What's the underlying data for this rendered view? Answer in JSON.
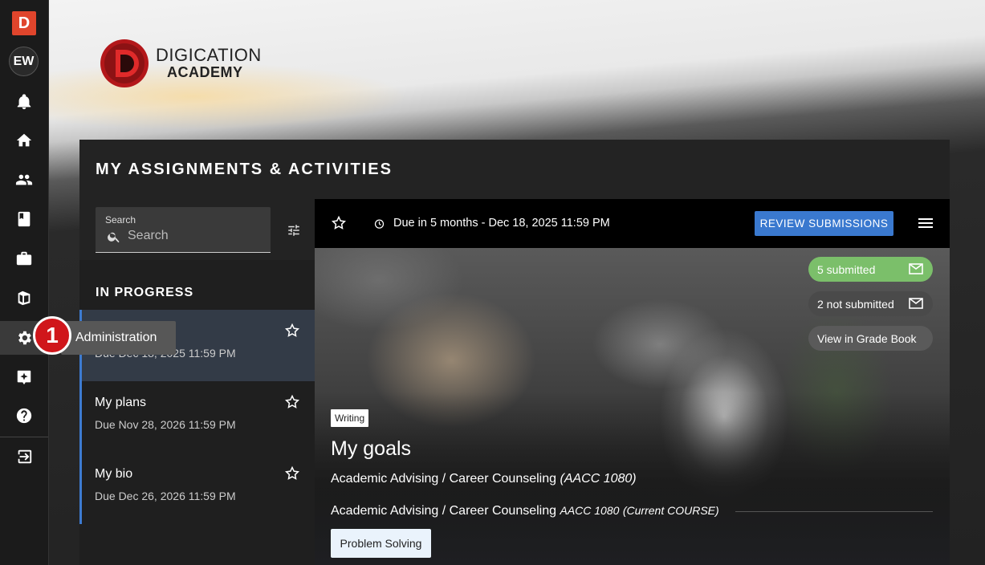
{
  "rail": {
    "logo_letter": "D",
    "avatar_initials": "EW"
  },
  "tooltip": {
    "label": "Administration"
  },
  "step_badge": {
    "number": "1"
  },
  "brand": {
    "line1": "DIGICATION",
    "line2": "ACADEMY"
  },
  "panel": {
    "title": "MY ASSIGNMENTS & ACTIVITIES"
  },
  "search": {
    "label": "Search",
    "placeholder": "Search"
  },
  "list": {
    "heading": "IN PROGRESS",
    "items": [
      {
        "title": "",
        "due": "Due Dec 18, 2025 11:59 PM"
      },
      {
        "title": "My plans",
        "due": "Due Nov 28, 2026 11:59 PM"
      },
      {
        "title": "My bio",
        "due": "Due Dec 26, 2026 11:59 PM"
      }
    ]
  },
  "detail": {
    "due_text": "Due in 5 months - Dec 18, 2025 11:59 PM",
    "review_label": "REVIEW SUBMISSIONS",
    "submitted": "5 submitted",
    "not_submitted": "2 not submitted",
    "grade_book": "View in Grade Book",
    "tag": "Writing",
    "title": "My goals",
    "subtitle_name": "Academic Advising / Career Counseling",
    "subtitle_code": "(AACC 1080)",
    "course_name": "Academic Advising / Career Counseling",
    "course_code": "AACC 1080",
    "course_status": "(Current COURSE)",
    "chip": "Problem Solving"
  },
  "colors": {
    "accent_blue": "#3a79cf",
    "submitted_green": "#7bbf6a",
    "badge_red": "#d0161b",
    "logo_red": "#e0452c"
  }
}
